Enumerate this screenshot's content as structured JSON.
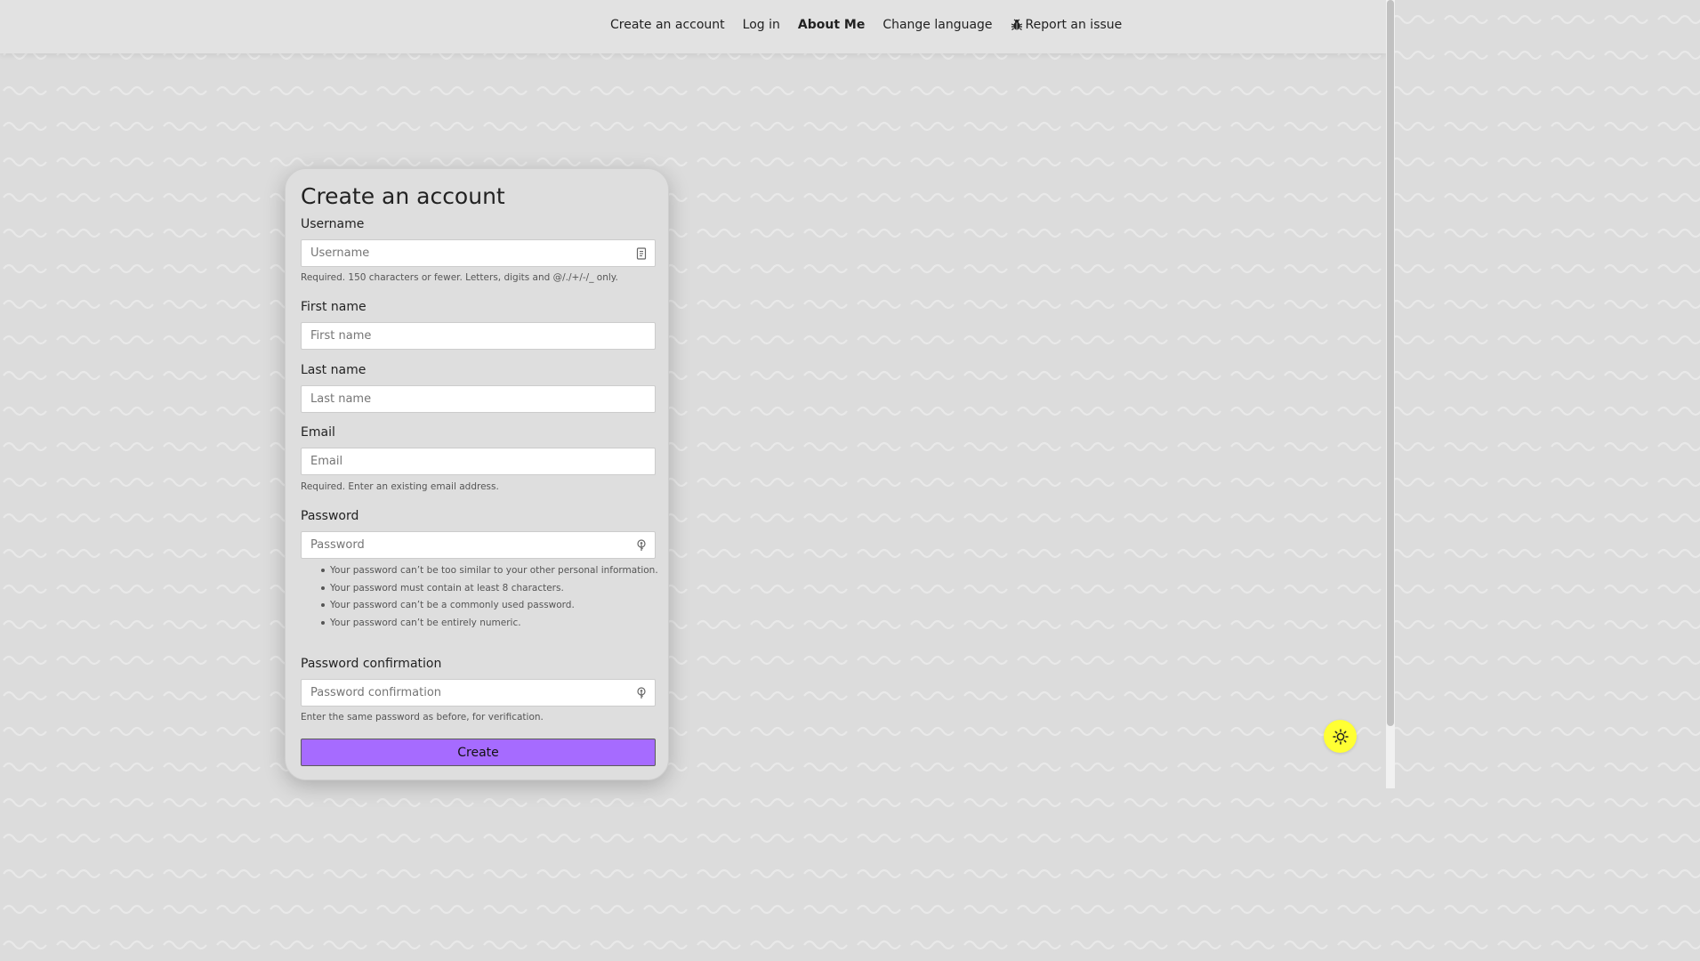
{
  "nav": {
    "create_account": "Create an account",
    "log_in": "Log in",
    "about_me": "About Me",
    "change_language": "Change language",
    "report_issue": "Report an issue"
  },
  "form": {
    "title": "Create an account",
    "username": {
      "label": "Username",
      "placeholder": "Username",
      "help": "Required. 150 characters or fewer. Letters, digits and @/./+/-/_ only."
    },
    "first_name": {
      "label": "First name",
      "placeholder": "First name"
    },
    "last_name": {
      "label": "Last name",
      "placeholder": "Last name"
    },
    "email": {
      "label": "Email",
      "placeholder": "Email",
      "help": "Required. Enter an existing email address."
    },
    "password": {
      "label": "Password",
      "placeholder": "Password",
      "rules": [
        "Your password can’t be too similar to your other personal information.",
        "Your password must contain at least 8 characters.",
        "Your password can’t be a commonly used password.",
        "Your password can’t be entirely numeric."
      ]
    },
    "password_confirmation": {
      "label": "Password confirmation",
      "placeholder": "Password confirmation",
      "help": "Enter the same password as before, for verification."
    },
    "submit": "Create"
  },
  "theme": {
    "toggle_icon": "sun-icon",
    "toggle_color": "#ffff33"
  },
  "colors": {
    "accent": "#a66bff",
    "background": "#dcdcdc"
  }
}
